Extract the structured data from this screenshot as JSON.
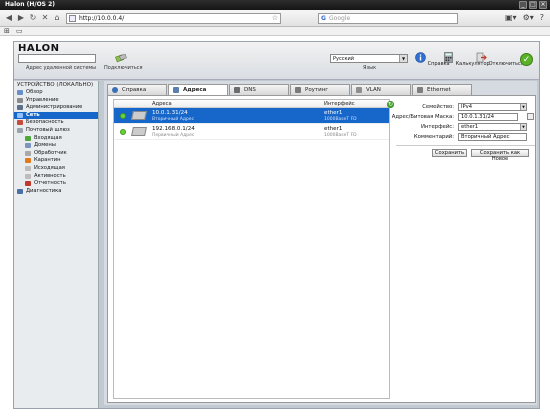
{
  "window": {
    "title": "Halon (H/OS 2)"
  },
  "browser": {
    "url": "http://10.0.0.4/",
    "search_placeholder": "Google",
    "search_engine_glyph": "G"
  },
  "app": {
    "logo": "HALON",
    "remote_address_label": "Адрес удаленной системы",
    "remote_address_value": "",
    "connect_label": "Подключиться",
    "language_value": "Русский",
    "language_label": "Язык",
    "help_label": "Справка",
    "calculator_label": "Калькулятор",
    "disconnect_label": "Отключиться"
  },
  "sidebar": {
    "header": "УСТРОЙСТВО (ЛОКАЛЬНО)",
    "items": [
      {
        "label": "Обзор",
        "icon": "overview-icon",
        "color": "#6a8fc7"
      },
      {
        "label": "Управление",
        "icon": "management-icon",
        "color": "#8a8a8a"
      },
      {
        "label": "Администрирование",
        "icon": "admin-icon",
        "color": "#5c6f8a"
      },
      {
        "label": "Сеть",
        "icon": "network-icon",
        "color": "#2a7be0"
      },
      {
        "label": "Безопасность",
        "icon": "security-icon",
        "color": "#c84a3a"
      },
      {
        "label": "Почтовый шлюз",
        "icon": "mail-gateway-icon",
        "color": "#9aa3ad"
      },
      {
        "label": "Входящая",
        "icon": "inbound-icon",
        "color": "#4fa63c"
      },
      {
        "label": "Домены",
        "icon": "domains-icon",
        "color": "#7c94c0"
      },
      {
        "label": "Обработчик",
        "icon": "handler-icon",
        "color": "#a9a9a9"
      },
      {
        "label": "Карантин",
        "icon": "quarantine-icon",
        "color": "#e07a1a"
      },
      {
        "label": "Исходящая",
        "icon": "outbound-icon",
        "color": "#bcbcbc"
      },
      {
        "label": "Активность",
        "icon": "activity-icon",
        "color": "#bcbcbc"
      },
      {
        "label": "Отчетность",
        "icon": "reports-icon",
        "color": "#c0392b"
      },
      {
        "label": "Диагностика",
        "icon": "diagnostics-icon",
        "color": "#4a6fa5"
      }
    ]
  },
  "tabs": [
    {
      "label": "Справка",
      "icon": "help-icon",
      "color": "#3b6fb6"
    },
    {
      "label": "Адреса",
      "icon": "addresses-icon",
      "color": "#5b7fb0"
    },
    {
      "label": "DNS",
      "icon": "dns-icon",
      "color": "#6c6c6c"
    },
    {
      "label": "Роутинг",
      "icon": "routing-icon",
      "color": "#7a7a7a"
    },
    {
      "label": "VLAN",
      "icon": "vlan-icon",
      "color": "#8e8e8e"
    },
    {
      "label": "Ethernet",
      "icon": "ethernet-icon",
      "color": "#7e7e7e"
    }
  ],
  "list": {
    "col_address": "Адреса",
    "col_interface": "Интерфейс",
    "rows": [
      {
        "address": "10.0.1.31/24",
        "address_sub": "Вторичный Адрес",
        "interface": "ether1",
        "interface_sub": "1000BaseT FD"
      },
      {
        "address": "192.168.0.1/24",
        "address_sub": "Первичный Адрес",
        "interface": "ether1",
        "interface_sub": "1000BaseT FD"
      }
    ]
  },
  "form": {
    "family_label": "Семейство:",
    "family_value": "IPv4",
    "address_label": "Адрес/Битовая Маска:",
    "address_value": "10.0.1.31/24",
    "interface_label": "Интерфейс:",
    "interface_value": "ether1",
    "comment_label": "Комментарий:",
    "comment_value": "Вторичный Адрес",
    "save_label": "Сохранить",
    "save_new_label": "Сохранить как Новое"
  },
  "colors": {
    "accent": "#1667c9",
    "ok": "#5ab226",
    "status_up": "#6ad13d"
  }
}
